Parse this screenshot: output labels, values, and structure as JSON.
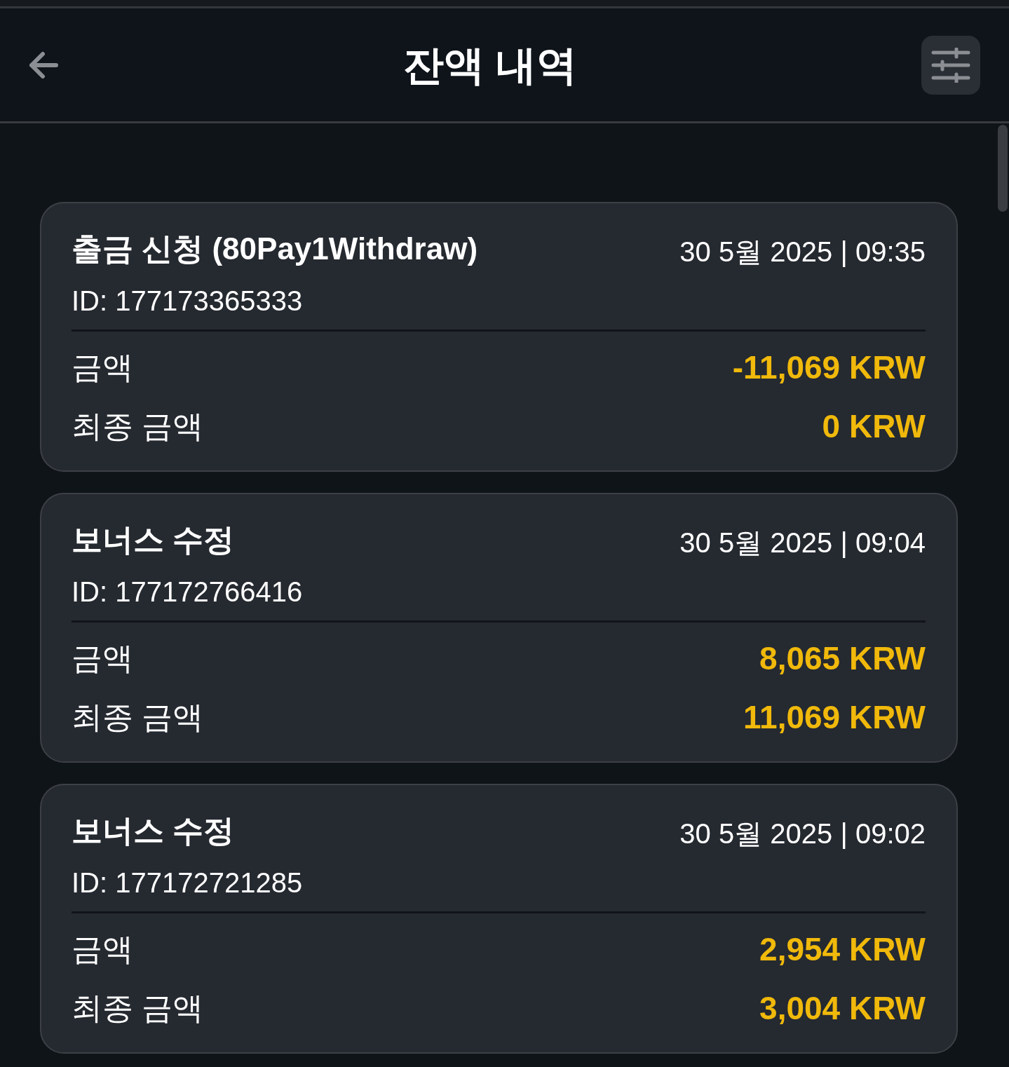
{
  "header": {
    "title": "잔액 내역"
  },
  "transactions": [
    {
      "title": "출금 신청 (80Pay1Withdraw)",
      "date": "30 5월 2025 | 09:35",
      "id": "ID: 177173365333",
      "rows": [
        {
          "label": "금액",
          "value": "-11,069 KRW"
        },
        {
          "label": "최종 금액",
          "value": "0 KRW"
        }
      ]
    },
    {
      "title": "보너스 수정",
      "date": "30 5월 2025 | 09:04",
      "id": "ID: 177172766416",
      "rows": [
        {
          "label": "금액",
          "value": "8,065 KRW"
        },
        {
          "label": "최종 금액",
          "value": "11,069 KRW"
        }
      ]
    },
    {
      "title": "보너스 수정",
      "date": "30 5월 2025 | 09:02",
      "id": "ID: 177172721285",
      "rows": [
        {
          "label": "금액",
          "value": "2,954 KRW"
        },
        {
          "label": "최종 금액",
          "value": "3,004 KRW"
        }
      ]
    }
  ]
}
